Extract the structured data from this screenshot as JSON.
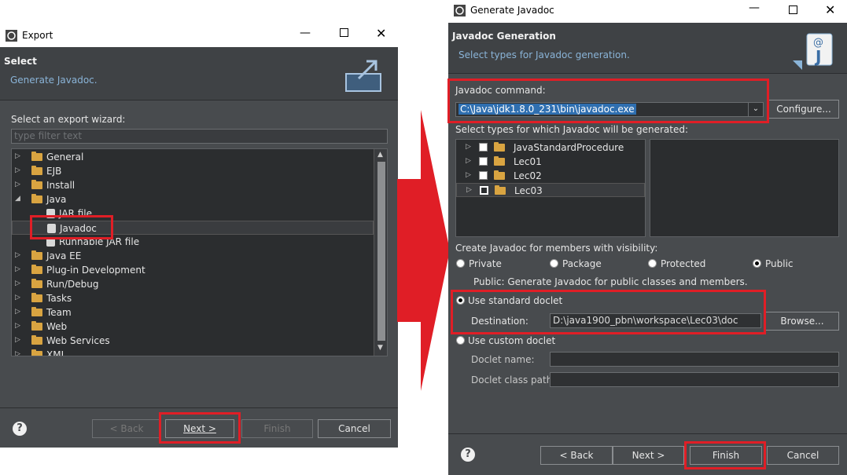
{
  "export": {
    "title": "Export",
    "header_title": "Select",
    "header_subtitle": "Generate Javadoc.",
    "filter_label": "Select an export wizard:",
    "filter_placeholder": "type filter text",
    "tree": [
      {
        "label": "General",
        "type": "folder"
      },
      {
        "label": "EJB",
        "type": "folder"
      },
      {
        "label": "Install",
        "type": "folder"
      },
      {
        "label": "Java",
        "type": "folder",
        "expanded": true
      },
      {
        "label": "JAR file",
        "type": "item"
      },
      {
        "label": "Javadoc",
        "type": "item",
        "selected": true
      },
      {
        "label": "Runnable JAR file",
        "type": "item"
      },
      {
        "label": "Java EE",
        "type": "folder"
      },
      {
        "label": "Plug-in Development",
        "type": "folder"
      },
      {
        "label": "Run/Debug",
        "type": "folder"
      },
      {
        "label": "Tasks",
        "type": "folder"
      },
      {
        "label": "Team",
        "type": "folder"
      },
      {
        "label": "Web",
        "type": "folder"
      },
      {
        "label": "Web Services",
        "type": "folder"
      },
      {
        "label": "XML",
        "type": "folder"
      }
    ],
    "buttons": {
      "back": "< Back",
      "next": "Next >",
      "finish": "Finish",
      "cancel": "Cancel"
    }
  },
  "javadoc": {
    "title": "Generate Javadoc",
    "header_title": "Javadoc Generation",
    "header_subtitle": "Select types for Javadoc generation.",
    "command_label": "Javadoc command:",
    "command_value": "C:\\Java\\jdk1.8.0_231\\bin\\javadoc.exe",
    "configure": "Configure...",
    "types_label": "Select types for which Javadoc will be generated:",
    "projects": [
      "JavaStandardProcedure",
      "Lec01",
      "Lec02",
      "Lec03"
    ],
    "visibility_label": "Create Javadoc for members with visibility:",
    "visibility": {
      "private": "Private",
      "package": "Package",
      "protected": "Protected",
      "public": "Public",
      "selected": "Public"
    },
    "visibility_note": "Public: Generate Javadoc for public classes and members.",
    "standard_doclet": "Use standard doclet",
    "destination_label": "Destination:",
    "destination_value": "D:\\java1900_pbn\\workspace\\Lec03\\doc",
    "browse": "Browse...",
    "custom_doclet": "Use custom doclet",
    "doclet_name_label": "Doclet name:",
    "doclet_classpath_label": "Doclet class path:",
    "buttons": {
      "back": "< Back",
      "next": "Next >",
      "finish": "Finish",
      "cancel": "Cancel"
    }
  },
  "colors": {
    "highlight": "#e01e26",
    "arrow": "#e01e26",
    "dialog_bg": "#484b4e"
  }
}
